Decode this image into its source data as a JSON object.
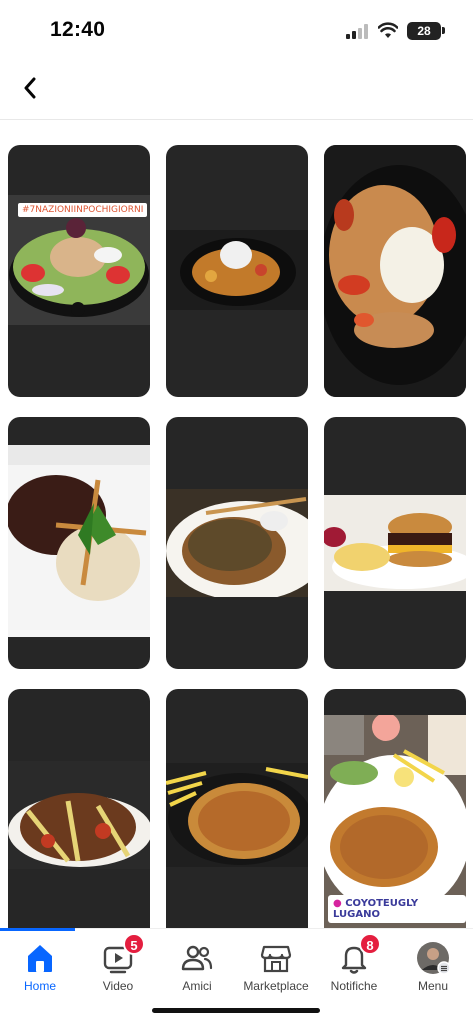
{
  "status": {
    "time": "12:40",
    "battery": "28"
  },
  "nav": {
    "back_icon": "chevron-left-icon"
  },
  "grid": {
    "tiles": [
      {
        "name": "story-salad",
        "tag": "#7NAZIONIINPOCHIGIORNI"
      },
      {
        "name": "story-rice-plate"
      },
      {
        "name": "story-chicken-rice"
      },
      {
        "name": "story-steak-rice"
      },
      {
        "name": "story-steak-sauce"
      },
      {
        "name": "story-burger"
      },
      {
        "name": "story-pasta"
      },
      {
        "name": "story-schnitzel-fries"
      },
      {
        "name": "story-schnitzel-location",
        "tag": "COYOTEUGLY LUGANO"
      }
    ]
  },
  "tabs": [
    {
      "label": "Home",
      "icon": "home-icon",
      "active": true
    },
    {
      "label": "Video",
      "icon": "video-icon",
      "badge": "5"
    },
    {
      "label": "Amici",
      "icon": "friends-icon"
    },
    {
      "label": "Marketplace",
      "icon": "marketplace-icon"
    },
    {
      "label": "Notifiche",
      "icon": "bell-icon",
      "badge": "8"
    },
    {
      "label": "Menu",
      "icon": "avatar-icon"
    }
  ],
  "colors": {
    "accent": "#0866ff",
    "badge": "#e41e3f",
    "tile_bg": "#262626"
  }
}
